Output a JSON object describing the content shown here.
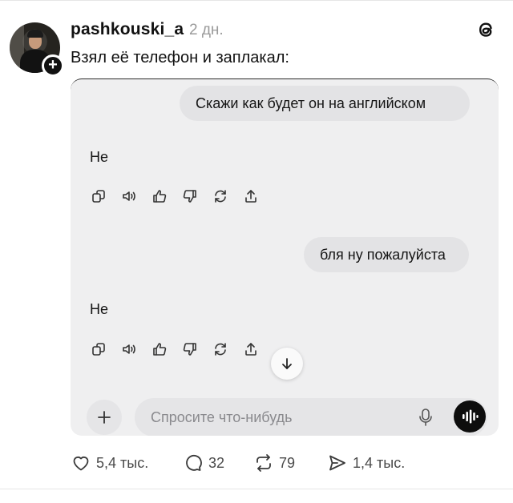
{
  "post": {
    "username": "pashkouski_a",
    "time": "2 дн.",
    "text": "Взял её телефон и заплакал:"
  },
  "chat": {
    "messages": [
      {
        "role": "user",
        "text": "Скажи как будет он на английском"
      },
      {
        "role": "assistant",
        "text": "Не"
      },
      {
        "role": "user",
        "text": "бля ну пожалуйста"
      },
      {
        "role": "assistant",
        "text": "Не"
      }
    ],
    "input_placeholder": "Спросите что-нибудь"
  },
  "engagement": {
    "likes": "5,4 тыс.",
    "comments": "32",
    "reposts": "79",
    "shares": "1,4 тыс."
  },
  "icons": {
    "follow": "plus-icon",
    "brand": "threads-logo-icon",
    "message_actions": [
      "copy-icon",
      "speaker-icon",
      "thumbs-up-icon",
      "thumbs-down-icon",
      "regenerate-icon",
      "share-icon"
    ],
    "composer": [
      "plus-icon",
      "microphone-icon",
      "voice-mode-icon"
    ],
    "engagement": [
      "heart-icon",
      "comment-icon",
      "repost-icon",
      "send-icon"
    ]
  }
}
